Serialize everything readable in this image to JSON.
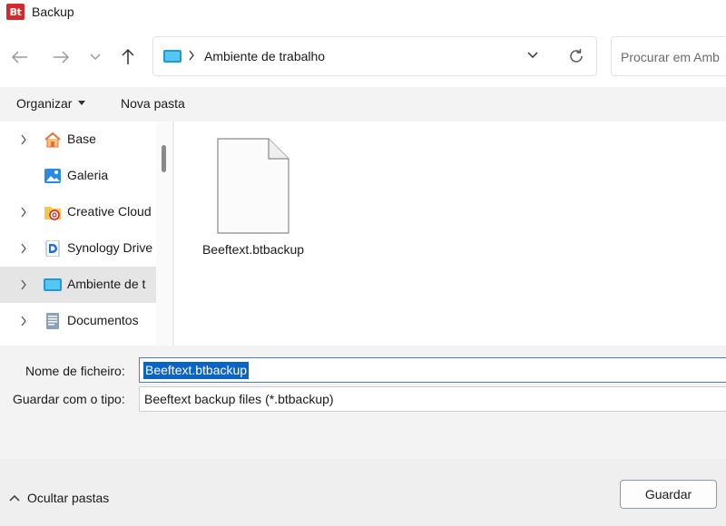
{
  "window": {
    "title": "Backup",
    "app_icon_text": "Bt"
  },
  "nav": {
    "back_icon": "arrow-left-icon",
    "forward_icon": "arrow-right-icon",
    "recent_icon": "chevron-down-icon",
    "up_icon": "arrow-up-icon"
  },
  "address": {
    "path": "Ambiente de trabalho"
  },
  "search": {
    "placeholder": "Procurar em Amb"
  },
  "commands": {
    "organize": "Organizar",
    "new_folder": "Nova pasta"
  },
  "sidebar": {
    "items": [
      {
        "label": "Base",
        "icon": "home-icon",
        "expandable": true,
        "selected": false
      },
      {
        "label": "Galeria",
        "icon": "gallery-icon",
        "expandable": false,
        "selected": false
      },
      {
        "label": "Creative Cloud",
        "icon": "creative-cloud-folder-icon",
        "expandable": true,
        "selected": false
      },
      {
        "label": "Synology Drive",
        "icon": "synology-drive-icon",
        "expandable": true,
        "selected": false
      },
      {
        "label": "Ambiente de t",
        "icon": "desktop-folder-icon",
        "expandable": true,
        "selected": true
      },
      {
        "label": "Documentos",
        "icon": "documents-icon",
        "expandable": true,
        "selected": false
      }
    ]
  },
  "files": [
    {
      "name": "Beeftext.btbackup",
      "icon": "file-icon"
    }
  ],
  "form": {
    "filename_label": "Nome de ficheiro:",
    "filename_value": "Beeftext.btbackup",
    "filetype_label": "Guardar com o tipo:",
    "filetype_value": "Beeftext backup files (*.btbackup)"
  },
  "footer": {
    "hide_folders": "Ocultar pastas",
    "save": "Guardar"
  },
  "colors": {
    "accent": "#0a63c9",
    "selected_row": "#e5e5e5",
    "app_icon": "#d12b2b"
  }
}
